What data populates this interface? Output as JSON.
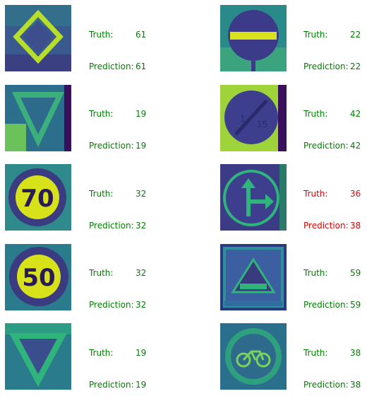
{
  "samples": [
    {
      "truth_label": "Truth:",
      "truth": "61",
      "pred_label": "Prediction:",
      "prediction": "61",
      "correct": true,
      "sign": "diamond-sign"
    },
    {
      "truth_label": "Truth:",
      "truth": "22",
      "pred_label": "Prediction:",
      "prediction": "22",
      "correct": true,
      "sign": "no-entry-sign"
    },
    {
      "truth_label": "Truth:",
      "truth": "19",
      "pred_label": "Prediction:",
      "prediction": "19",
      "correct": true,
      "sign": "yield-sign"
    },
    {
      "truth_label": "Truth:",
      "truth": "42",
      "pred_label": "Prediction:",
      "prediction": "42",
      "correct": true,
      "sign": "parking-restriction-sign"
    },
    {
      "truth_label": "Truth:",
      "truth": "32",
      "pred_label": "Prediction:",
      "prediction": "32",
      "correct": true,
      "sign": "speed-limit-70-sign",
      "text": "70"
    },
    {
      "truth_label": "Truth:",
      "truth": "36",
      "pred_label": "Prediction:",
      "prediction": "38",
      "correct": false,
      "sign": "straight-or-right-sign"
    },
    {
      "truth_label": "Truth:",
      "truth": "32",
      "pred_label": "Prediction:",
      "prediction": "32",
      "correct": true,
      "sign": "speed-limit-50-sign",
      "text": "50"
    },
    {
      "truth_label": "Truth:",
      "truth": "59",
      "pred_label": "Prediction:",
      "prediction": "59",
      "correct": true,
      "sign": "warning-triangle-panel-sign"
    },
    {
      "truth_label": "Truth:",
      "truth": "19",
      "pred_label": "Prediction:",
      "prediction": "19",
      "correct": true,
      "sign": "yield-sign"
    },
    {
      "truth_label": "Truth:",
      "truth": "38",
      "pred_label": "Prediction:",
      "prediction": "38",
      "correct": true,
      "sign": "bicycle-sign"
    }
  ],
  "colors": {
    "correct": "#008000",
    "incorrect": "#e00000",
    "dark": "#44106a",
    "mid": "#2b7f8e",
    "light": "#2fb47c",
    "bright": "#d7e21a"
  }
}
